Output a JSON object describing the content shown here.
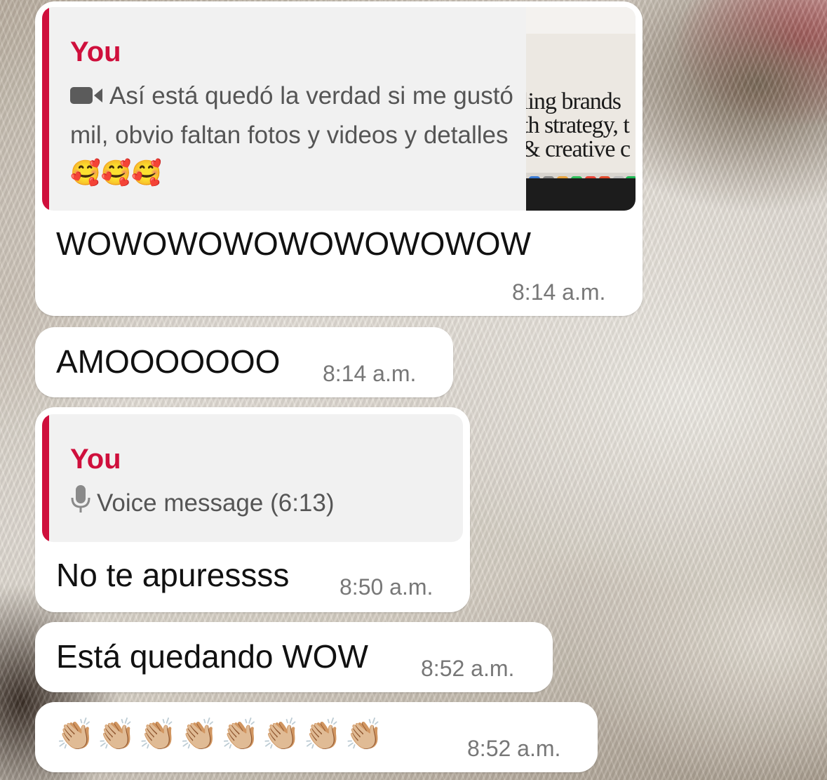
{
  "messages": [
    {
      "reply": {
        "author": "You",
        "icon": "video-camera-icon",
        "text": "Así está quedó la verdad si me gustó mil, obvio faltan fotos y videos y detalles 🥰🥰🥰",
        "thumbnail_headline": "ling brands th strategy, t & creative c"
      },
      "text": "WOWOWOWOWOWOWOWOW",
      "time": "8:14 a.m."
    },
    {
      "text": "AMOOOOOOO",
      "time": "8:14 a.m."
    },
    {
      "reply": {
        "author": "You",
        "icon": "microphone-icon",
        "text": "Voice message (6:13)"
      },
      "text": "No te apuressss",
      "time": "8:50 a.m."
    },
    {
      "text": "Está quedando WOW",
      "time": "8:52 a.m."
    },
    {
      "text": "👏🏼👏🏼👏🏼👏🏼👏🏼👏🏼👏🏼👏🏼",
      "time": "8:52 a.m."
    }
  ],
  "colors": {
    "reply_accent": "#cf0f3c",
    "bubble": "#ffffff",
    "quote_background": "#f1f1f1"
  }
}
